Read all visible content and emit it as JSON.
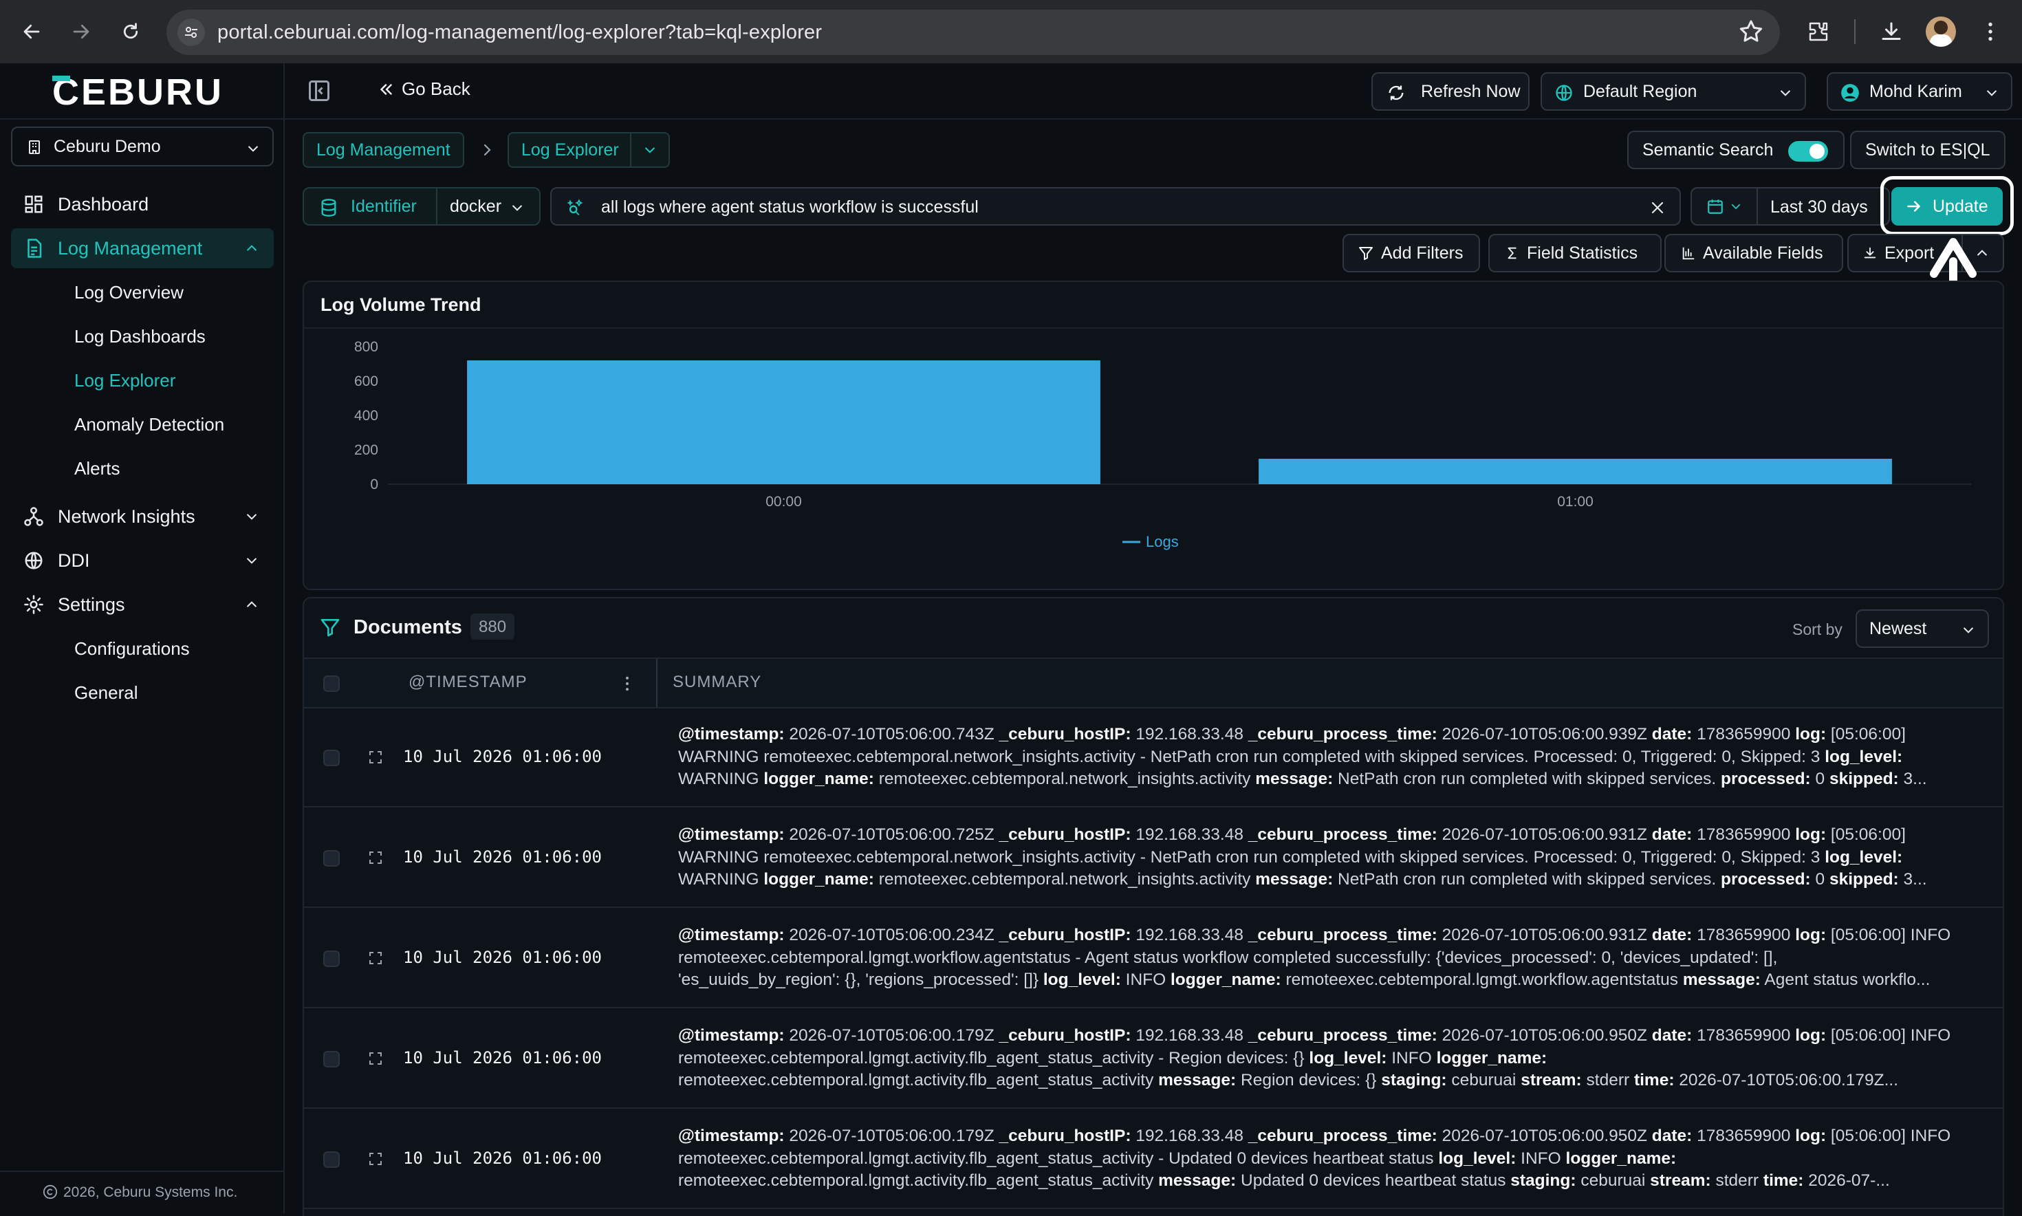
{
  "browser": {
    "url": "portal.ceburuai.com/log-management/log-explorer?tab=kql-explorer"
  },
  "sidebar": {
    "logo_text": "CEBURU",
    "org": "Ceburu Demo",
    "items": [
      {
        "label": "Dashboard"
      },
      {
        "label": "Log Management"
      },
      {
        "label": "Network Insights"
      },
      {
        "label": "DDI"
      },
      {
        "label": "Settings"
      }
    ],
    "log_management_children": [
      "Log Overview",
      "Log Dashboards",
      "Log Explorer",
      "Anomaly Detection",
      "Alerts"
    ],
    "settings_children": [
      "Configurations",
      "General"
    ],
    "copyright": "2026, Ceburu Systems Inc."
  },
  "topbar": {
    "go_back": "Go Back",
    "refresh": "Refresh Now",
    "region": "Default Region",
    "user": "Mohd Karim"
  },
  "breadcrumb": {
    "root": "Log Management",
    "current": "Log Explorer"
  },
  "toolbar": {
    "semantic_search": "Semantic Search",
    "switch_esql": "Switch to ES|QL",
    "identifier_label": "Identifier",
    "identifier_value": "docker",
    "query": "all logs where agent status workflow is successful",
    "time_range": "Last 30 days",
    "update": "Update",
    "add_filters": "Add Filters",
    "field_statistics": "Field Statistics",
    "available_fields": "Available Fields",
    "export": "Export"
  },
  "chart_data": {
    "type": "bar",
    "title": "Log Volume Trend",
    "categories": [
      "00:00",
      "01:00"
    ],
    "series": [
      {
        "name": "Logs",
        "values": [
          720,
          148
        ]
      }
    ],
    "ylim": [
      0,
      800
    ],
    "yticks": [
      0,
      200,
      400,
      600,
      800
    ],
    "legend": "bottom-center",
    "color": "#38a9e0"
  },
  "documents": {
    "title": "Documents",
    "count": "880",
    "sort_label": "Sort by",
    "sort_value": "Newest",
    "col_timestamp": "@TIMESTAMP",
    "col_summary": "SUMMARY",
    "rows": [
      {
        "timestamp": "10 Jul 2026 01:06:00",
        "line1": [
          [
            "@timestamp:",
            " 2026-07-10T05:06:00.743Z "
          ],
          [
            "_ceburu_hostIP:",
            " 192.168.33.48 "
          ],
          [
            "_ceburu_process_time:",
            " 2026-07-10T05:06:00.939Z "
          ],
          [
            "date:",
            " 1783659900 "
          ],
          [
            "log:",
            " [05:06:00]"
          ]
        ],
        "line2": [
          [
            "",
            "WARNING remoteexec.cebtemporal.network_insights.activity - NetPath cron run completed with skipped services. Processed: 0, Triggered: 0, Skipped: 3 "
          ],
          [
            "log_level:",
            ""
          ]
        ],
        "line3": [
          [
            "",
            "WARNING "
          ],
          [
            "logger_name:",
            " remoteexec.cebtemporal.network_insights.activity "
          ],
          [
            "message:",
            " NetPath cron run completed with skipped services. "
          ],
          [
            "processed:",
            " 0 "
          ],
          [
            "skipped:",
            " 3..."
          ]
        ]
      },
      {
        "timestamp": "10 Jul 2026 01:06:00",
        "line1": [
          [
            "@timestamp:",
            " 2026-07-10T05:06:00.725Z "
          ],
          [
            "_ceburu_hostIP:",
            " 192.168.33.48 "
          ],
          [
            "_ceburu_process_time:",
            " 2026-07-10T05:06:00.931Z "
          ],
          [
            "date:",
            " 1783659900 "
          ],
          [
            "log:",
            " [05:06:00]"
          ]
        ],
        "line2": [
          [
            "",
            "WARNING remoteexec.cebtemporal.network_insights.activity - NetPath cron run completed with skipped services. Processed: 0, Triggered: 0, Skipped: 3 "
          ],
          [
            "log_level:",
            ""
          ]
        ],
        "line3": [
          [
            "",
            "WARNING "
          ],
          [
            "logger_name:",
            " remoteexec.cebtemporal.network_insights.activity "
          ],
          [
            "message:",
            " NetPath cron run completed with skipped services. "
          ],
          [
            "processed:",
            " 0 "
          ],
          [
            "skipped:",
            " 3..."
          ]
        ]
      },
      {
        "timestamp": "10 Jul 2026 01:06:00",
        "line1": [
          [
            "@timestamp:",
            " 2026-07-10T05:06:00.234Z "
          ],
          [
            "_ceburu_hostIP:",
            " 192.168.33.48 "
          ],
          [
            "_ceburu_process_time:",
            " 2026-07-10T05:06:00.931Z "
          ],
          [
            "date:",
            " 1783659900 "
          ],
          [
            "log:",
            " [05:06:00] INFO"
          ]
        ],
        "line2": [
          [
            "",
            "remoteexec.cebtemporal.lgmgt.workflow.agentstatus - Agent status workflow completed successfully: {'devices_processed': 0, 'devices_updated': [],"
          ]
        ],
        "line3": [
          [
            "",
            "'es_uuids_by_region': {}, 'regions_processed': []} "
          ],
          [
            "log_level:",
            " INFO "
          ],
          [
            "logger_name:",
            " remoteexec.cebtemporal.lgmgt.workflow.agentstatus "
          ],
          [
            "message:",
            " Agent status workflo..."
          ]
        ]
      },
      {
        "timestamp": "10 Jul 2026 01:06:00",
        "line1": [
          [
            "@timestamp:",
            " 2026-07-10T05:06:00.179Z "
          ],
          [
            "_ceburu_hostIP:",
            " 192.168.33.48 "
          ],
          [
            "_ceburu_process_time:",
            " 2026-07-10T05:06:00.950Z "
          ],
          [
            "date:",
            " 1783659900 "
          ],
          [
            "log:",
            " [05:06:00] INFO"
          ]
        ],
        "line2": [
          [
            "",
            "remoteexec.cebtemporal.lgmgt.activity.flb_agent_status_activity - Region devices: {} "
          ],
          [
            "log_level:",
            " INFO "
          ],
          [
            "logger_name:",
            ""
          ]
        ],
        "line3": [
          [
            "",
            "remoteexec.cebtemporal.lgmgt.activity.flb_agent_status_activity "
          ],
          [
            "message:",
            " Region devices: {} "
          ],
          [
            "staging:",
            " ceburuai "
          ],
          [
            "stream:",
            " stderr "
          ],
          [
            "time:",
            " 2026-07-10T05:06:00.179Z..."
          ]
        ]
      },
      {
        "timestamp": "10 Jul 2026 01:06:00",
        "line1": [
          [
            "@timestamp:",
            " 2026-07-10T05:06:00.179Z "
          ],
          [
            "_ceburu_hostIP:",
            " 192.168.33.48 "
          ],
          [
            "_ceburu_process_time:",
            " 2026-07-10T05:06:00.950Z "
          ],
          [
            "date:",
            " 1783659900 "
          ],
          [
            "log:",
            " [05:06:00] INFO"
          ]
        ],
        "line2": [
          [
            "",
            "remoteexec.cebtemporal.lgmgt.activity.flb_agent_status_activity - Updated 0 devices heartbeat status "
          ],
          [
            "log_level:",
            " INFO "
          ],
          [
            "logger_name:",
            ""
          ]
        ],
        "line3": [
          [
            "",
            "remoteexec.cebtemporal.lgmgt.activity.flb_agent_status_activity "
          ],
          [
            "message:",
            " Updated 0 devices heartbeat status "
          ],
          [
            "staging:",
            " ceburuai "
          ],
          [
            "stream:",
            " stderr "
          ],
          [
            "time:",
            " 2026-07-..."
          ]
        ]
      }
    ]
  },
  "colors": {
    "accent": "#22c3bd",
    "bar": "#38a9e0",
    "background": "#0b0f14"
  }
}
